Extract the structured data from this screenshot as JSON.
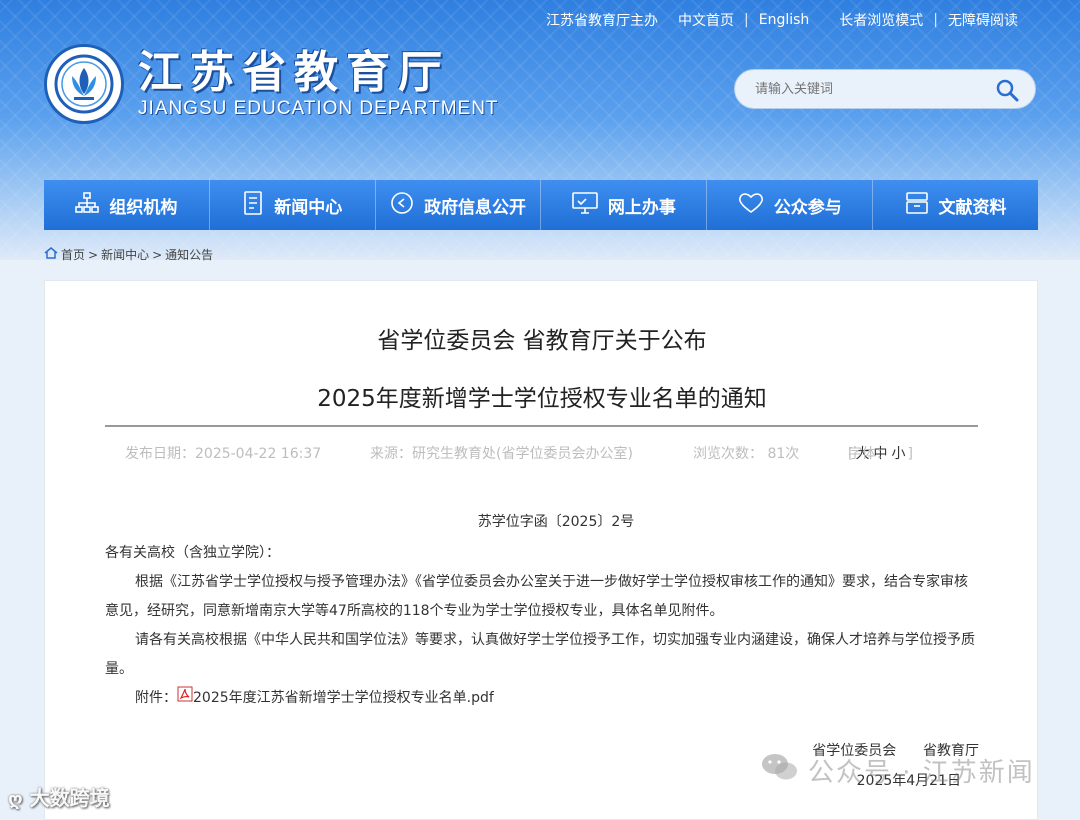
{
  "top_links": [
    "江苏省教育厅主办",
    "中文首页",
    "English",
    "长者浏览模式",
    "无障碍阅读"
  ],
  "site": {
    "title_cn": "江苏省教育厅",
    "title_en": "JIANGSU EDUCATION DEPARTMENT"
  },
  "search": {
    "placeholder": "请输入关键词"
  },
  "nav": [
    {
      "label": "组织机构",
      "icon": "org-chart-icon"
    },
    {
      "label": "新闻中心",
      "icon": "document-icon"
    },
    {
      "label": "政府信息公开",
      "icon": "info-circle-icon"
    },
    {
      "label": "网上办事",
      "icon": "monitor-icon"
    },
    {
      "label": "公众参与",
      "icon": "heart-icon"
    },
    {
      "label": "文献资料",
      "icon": "archive-icon"
    }
  ],
  "breadcrumb": [
    "首页",
    "新闻中心",
    "通知公告"
  ],
  "article": {
    "title_line1": "省学位委员会 省教育厅关于公布",
    "title_line2": "2025年度新增学士学位授权专业名单的通知",
    "publish": "发布日期：2025-04-22 16:37",
    "source": "来源：研究生教育处(省学位委员会办公室)",
    "views": "浏览次数： 81次",
    "font_label": "字体：",
    "font_sizes": [
      "大",
      "中",
      "小"
    ],
    "doc_number": "苏学位字函〔2025〕2号",
    "salutation": "各有关高校（含独立学院）：",
    "para1": "根据《江苏省学士学位授权与授予管理办法》《省学位委员会办公室关于进一步做好学士学位授权审核工作的通知》要求，结合专家审核意见，经研究，同意新增南京大学等47所高校的118个专业为学士学位授权专业，具体名单见附件。",
    "para2": "请各有关高校根据《中华人民共和国学位法》等要求，认真做好学士学位授予工作，切实加强专业内涵建设，确保人才培养与学位授予质量。",
    "attach_label": "附件：",
    "attach_file": "2025年度江苏省新增学士学位授权专业名单.pdf",
    "sign_orgs": "省学位委员会      省教育厅",
    "sign_date": "2025年4月21日"
  },
  "watermarks": {
    "wechat": "公众号 · 江苏新闻",
    "corner": "大数跨境"
  }
}
